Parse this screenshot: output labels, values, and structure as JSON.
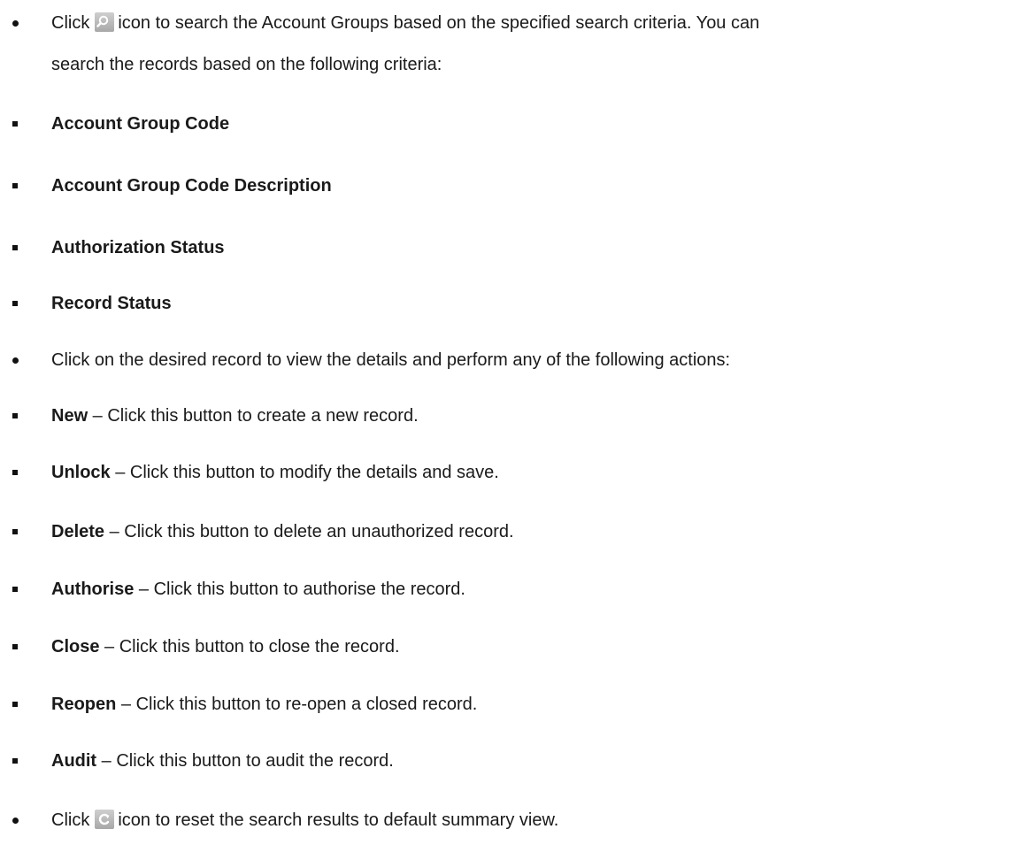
{
  "intro": {
    "before_icon": "Click",
    "after_icon": "icon to search the Account Groups based on the specified search criteria. You can",
    "line2": "search the records based on the following criteria:",
    "icon": "search-icon"
  },
  "criteria": [
    "Account Group Code",
    "Account Group Code Description",
    "Authorization Status",
    "Record Status"
  ],
  "actions_intro": "Click on the desired record to view the details and perform any of the following actions:",
  "actions": [
    {
      "name": "New",
      "desc": " – Click this button to create a new record."
    },
    {
      "name": "Unlock",
      "desc": " – Click this button to modify the details and save."
    },
    {
      "name": "Delete",
      "desc": " – Click this button to delete an unauthorized record."
    },
    {
      "name": "Authorise",
      "desc": " – Click this button to authorise the record."
    },
    {
      "name": "Close",
      "desc": " – Click this button to close the record."
    },
    {
      "name": "Reopen",
      "desc": " – Click this button to re-open a closed record."
    },
    {
      "name": "Audit",
      "desc": " – Click this button to audit the record."
    }
  ],
  "reset": {
    "before_icon": "Click",
    "after_icon": "icon to reset the search results to default summary view.",
    "icon": "reset-icon"
  }
}
